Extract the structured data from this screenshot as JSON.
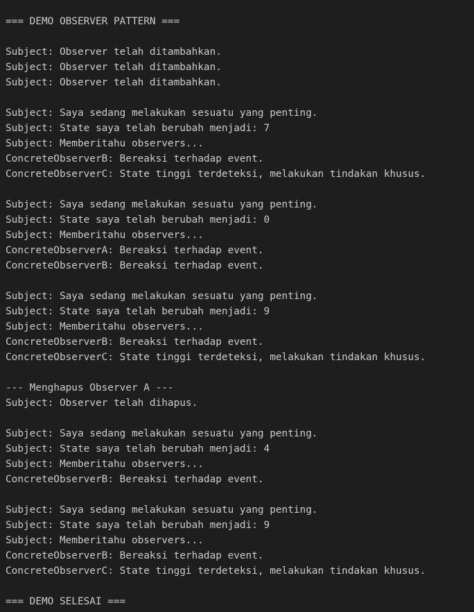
{
  "colors": {
    "background": "#1e1e1e",
    "text": "#cccccc"
  },
  "terminal": {
    "lines": [
      "=== DEMO OBSERVER PATTERN ===",
      "",
      "Subject: Observer telah ditambahkan.",
      "Subject: Observer telah ditambahkan.",
      "Subject: Observer telah ditambahkan.",
      "",
      "Subject: Saya sedang melakukan sesuatu yang penting.",
      "Subject: State saya telah berubah menjadi: 7",
      "Subject: Memberitahu observers...",
      "ConcreteObserverB: Bereaksi terhadap event.",
      "ConcreteObserverC: State tinggi terdeteksi, melakukan tindakan khusus.",
      "",
      "Subject: Saya sedang melakukan sesuatu yang penting.",
      "Subject: State saya telah berubah menjadi: 0",
      "Subject: Memberitahu observers...",
      "ConcreteObserverA: Bereaksi terhadap event.",
      "ConcreteObserverB: Bereaksi terhadap event.",
      "",
      "Subject: Saya sedang melakukan sesuatu yang penting.",
      "Subject: State saya telah berubah menjadi: 9",
      "Subject: Memberitahu observers...",
      "ConcreteObserverB: Bereaksi terhadap event.",
      "ConcreteObserverC: State tinggi terdeteksi, melakukan tindakan khusus.",
      "",
      "--- Menghapus Observer A ---",
      "Subject: Observer telah dihapus.",
      "",
      "Subject: Saya sedang melakukan sesuatu yang penting.",
      "Subject: State saya telah berubah menjadi: 4",
      "Subject: Memberitahu observers...",
      "ConcreteObserverB: Bereaksi terhadap event.",
      "",
      "Subject: Saya sedang melakukan sesuatu yang penting.",
      "Subject: State saya telah berubah menjadi: 9",
      "Subject: Memberitahu observers...",
      "ConcreteObserverB: Bereaksi terhadap event.",
      "ConcreteObserverC: State tinggi terdeteksi, melakukan tindakan khusus.",
      "",
      "=== DEMO SELESAI ==="
    ]
  }
}
